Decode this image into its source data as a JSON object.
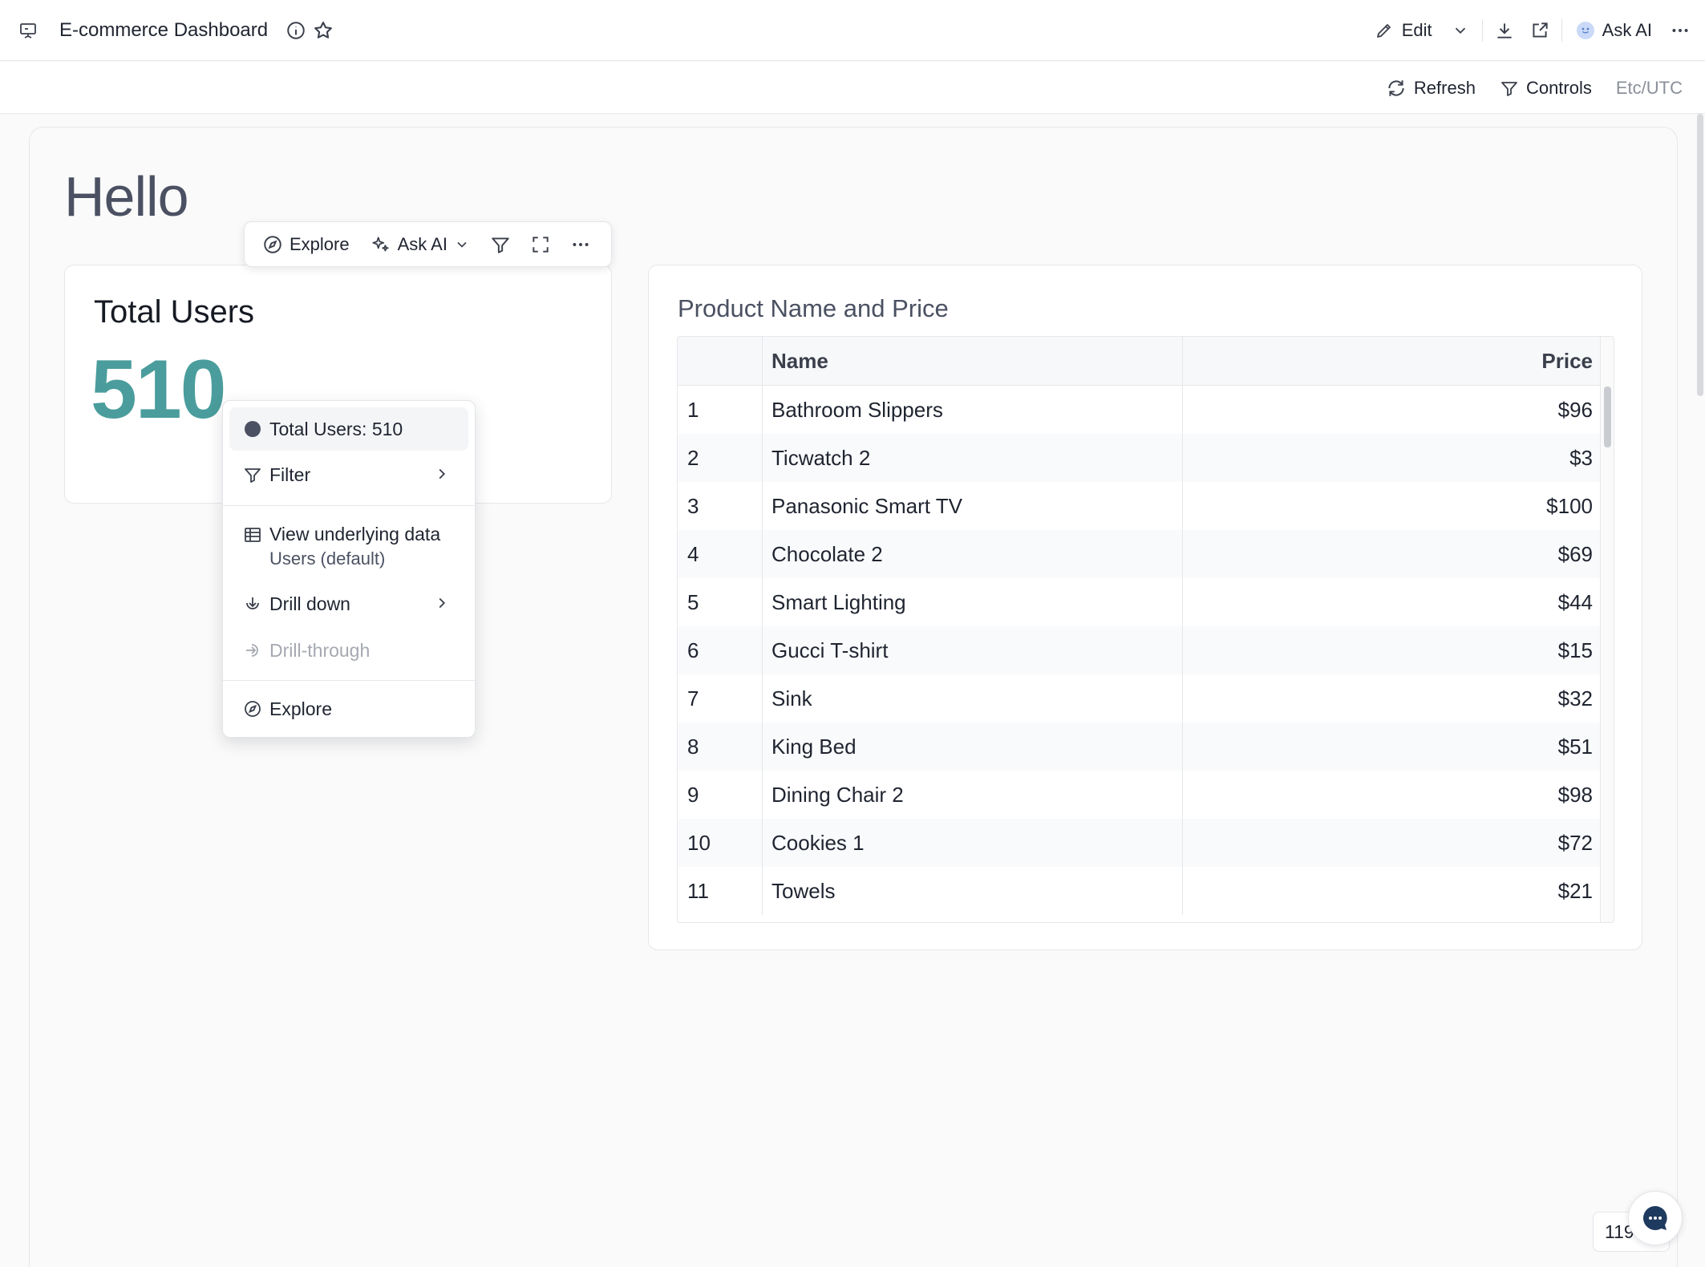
{
  "header": {
    "title": "E-commerce Dashboard",
    "edit_label": "Edit",
    "ask_ai_label": "Ask AI"
  },
  "subheader": {
    "refresh_label": "Refresh",
    "controls_label": "Controls",
    "timezone": "Etc/UTC"
  },
  "canvas": {
    "heading": "Hello"
  },
  "card_toolbar": {
    "explore_label": "Explore",
    "ask_ai_label": "Ask AI"
  },
  "kpi": {
    "title": "Total Users",
    "value": "510"
  },
  "context_menu": {
    "summary": "Total Users: 510",
    "filter": "Filter",
    "view_data": "View underlying data",
    "view_data_sub": "Users (default)",
    "drill_down": "Drill down",
    "drill_through": "Drill-through",
    "explore": "Explore"
  },
  "table": {
    "title": "Product Name and Price",
    "columns": [
      "",
      "Name",
      "Price"
    ],
    "rows": [
      [
        "1",
        "Bathroom Slippers",
        "$96"
      ],
      [
        "2",
        "Ticwatch 2",
        "$3"
      ],
      [
        "3",
        "Panasonic Smart TV",
        "$100"
      ],
      [
        "4",
        "Chocolate 2",
        "$69"
      ],
      [
        "5",
        "Smart Lighting",
        "$44"
      ],
      [
        "6",
        "Gucci T-shirt",
        "$15"
      ],
      [
        "7",
        "Sink",
        "$32"
      ],
      [
        "8",
        "King Bed",
        "$51"
      ],
      [
        "9",
        "Dining Chair 2",
        "$98"
      ],
      [
        "10",
        "Cookies 1",
        "$72"
      ],
      [
        "11",
        "Towels",
        "$21"
      ]
    ]
  },
  "footer": {
    "count_text": "119"
  },
  "icons": {
    "dashboard": "presentation-icon",
    "info": "info-icon",
    "star": "star-icon",
    "edit": "pencil-icon",
    "download": "download-icon",
    "share": "share-icon",
    "more": "more-icon",
    "refresh": "refresh-icon",
    "filter": "filter-icon",
    "explore": "compass-icon",
    "ask_ai": "sparkle-icon",
    "fullscreen": "expand-icon",
    "table": "table-icon",
    "drill_down": "arrow-down-circle-icon",
    "drill_through": "arrow-right-circle-icon",
    "chat": "chat-icon"
  },
  "colors": {
    "kpi_value": "#4a9d9c",
    "chat_bubble": "#1f3a5f",
    "series_dot": "#4b5162"
  }
}
